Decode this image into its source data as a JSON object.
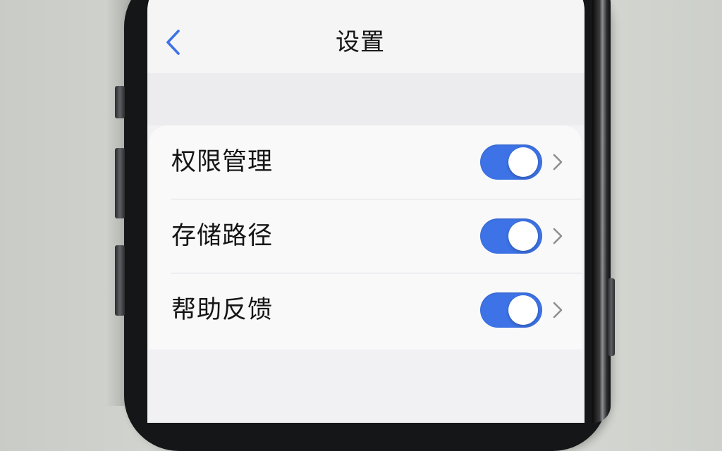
{
  "header": {
    "title": "设置",
    "back_icon": "chevron-left-icon"
  },
  "settings": {
    "items": [
      {
        "label": "权限管理",
        "toggle_on": true,
        "chevron_icon": "chevron-right-icon"
      },
      {
        "label": "存储路径",
        "toggle_on": true,
        "chevron_icon": "chevron-right-icon"
      },
      {
        "label": "帮助反馈",
        "toggle_on": true,
        "chevron_icon": "chevron-right-icon"
      }
    ]
  },
  "colors": {
    "accent": "#3d73e6",
    "background": "#f2f2f4",
    "text": "#151515",
    "chevron": "#8e8e93"
  }
}
